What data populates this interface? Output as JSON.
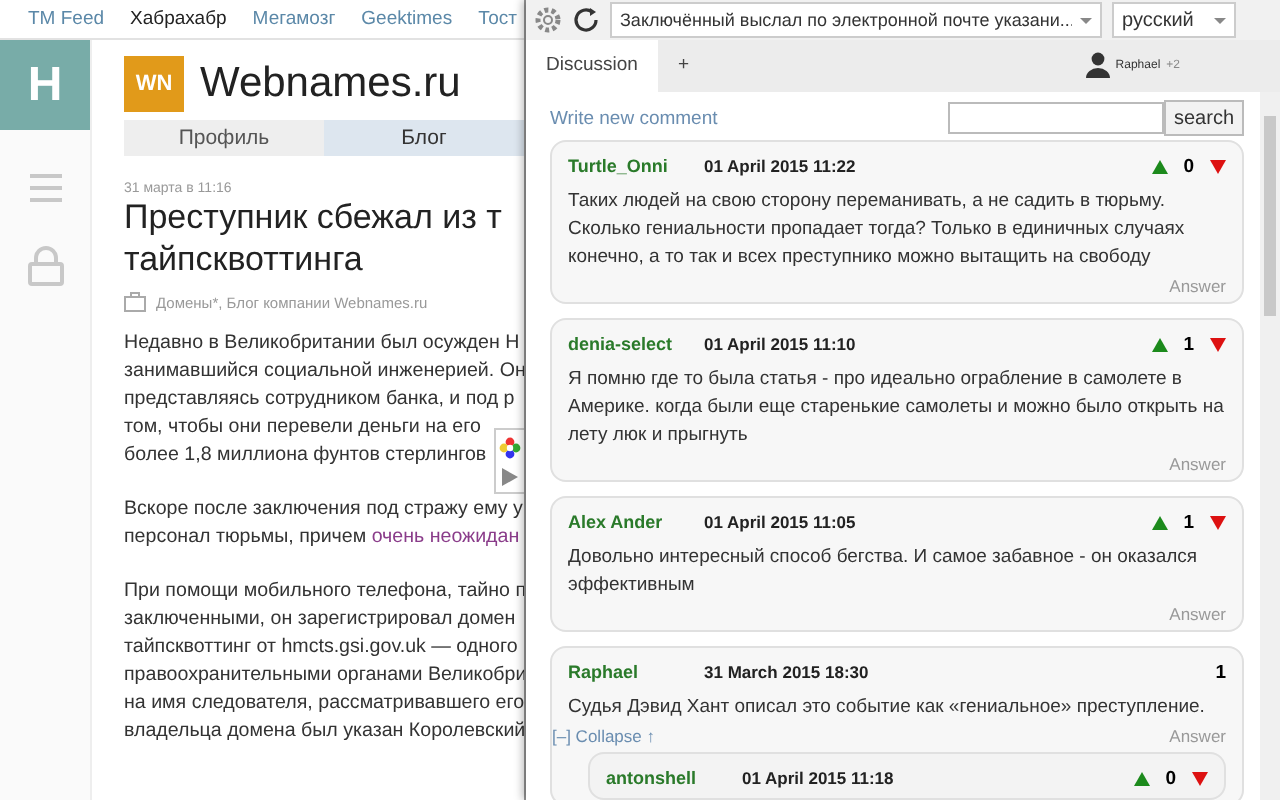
{
  "site_nav": [
    {
      "label": "TM Feed",
      "selected": false
    },
    {
      "label": "Хабрахабр",
      "selected": true
    },
    {
      "label": "Мегамозг",
      "selected": false
    },
    {
      "label": "Geektimes",
      "selected": false
    },
    {
      "label": "Тост",
      "selected": false
    }
  ],
  "sidebar": {
    "logo": "H"
  },
  "company": {
    "logo": "WN",
    "name": "Webnames.ru"
  },
  "company_tabs": [
    {
      "label": "Профиль",
      "selected": false
    },
    {
      "label": "Блог",
      "selected": true
    }
  ],
  "article": {
    "date": "31 марта в 11:16",
    "title_lines": [
      "Преступник сбежал из т",
      "тайпсквоттинга"
    ],
    "hubs": "Домены*, Блог компании Webnames.ru",
    "paragraphs": [
      {
        "lines": [
          "Недавно в Великобритании был осужден Н",
          "занимавшийся социальной инженерией. Он",
          "представляясь сотрудником банка, и под р",
          "том, чтобы они перевели деньги на его",
          "более 1,8 миллиона фунтов стерлингов"
        ]
      },
      {
        "lines": [
          "Вскоре после заключения под стражу ему у",
          "персонал тюрьмы, причем **очень неожидан**"
        ]
      },
      {
        "lines": [
          "При помощи мобильного телефона, тайно п",
          "заключенными, он зарегистрировал домен",
          "тайпсквоттинг от hmcts.gsi.gov.uk — одного",
          "правоохранительными органами Великобри",
          "на имя следователя, рассматривавшего его",
          "владельца домена был указан Королевский"
        ]
      }
    ]
  },
  "panel": {
    "page_title": "Заключённый выслал по электронной почте указани...",
    "language": "русский",
    "tabs": [
      {
        "label": "Discussion",
        "selected": true
      },
      {
        "label": "+",
        "selected": false
      }
    ],
    "user": {
      "name": "Raphael",
      "extra": "+2"
    },
    "write_link": "Write new comment",
    "search": {
      "button": "search"
    },
    "comments": [
      {
        "kind": "votable",
        "author": "Turtle_Onni",
        "date": "01 April 2015 11:22",
        "score": "0",
        "text": "Таких людей на свою сторону переманивать, а не садить в тюрьму. Сколько гениальности пропадает тогда? Только в единичных случаях конечно, а то так и всех преступнико можно вытащить на свободу",
        "answer": "Answer"
      },
      {
        "kind": "votable",
        "author": "denia-select",
        "date": "01 April 2015 11:10",
        "score": "1",
        "text": "Я помню где то была статья - про идеально ограбление в самолете в Америке. когда были еще старенькие самолеты и можно было открыть на лету люк и прыгнуть",
        "answer": "Answer"
      },
      {
        "kind": "votable",
        "author": "Alex Ander",
        "date": "01 April 2015 11:05",
        "score": "1",
        "text": "Довольно интересный способ бегства. И самое забавное - он оказался эффективным",
        "answer": "Answer"
      },
      {
        "kind": "own",
        "author": "Raphael",
        "date": "31 March 2015 18:30",
        "score": "1",
        "text": "Судья Дэвид Хант описал это событие как «гениальное» преступление.",
        "answer": "Answer",
        "collapse": "[–] Collapse ↑",
        "children": [
          {
            "kind": "votable",
            "author": "antonshell",
            "date": "01 April 2015 11:18",
            "score": "0"
          }
        ]
      }
    ]
  }
}
